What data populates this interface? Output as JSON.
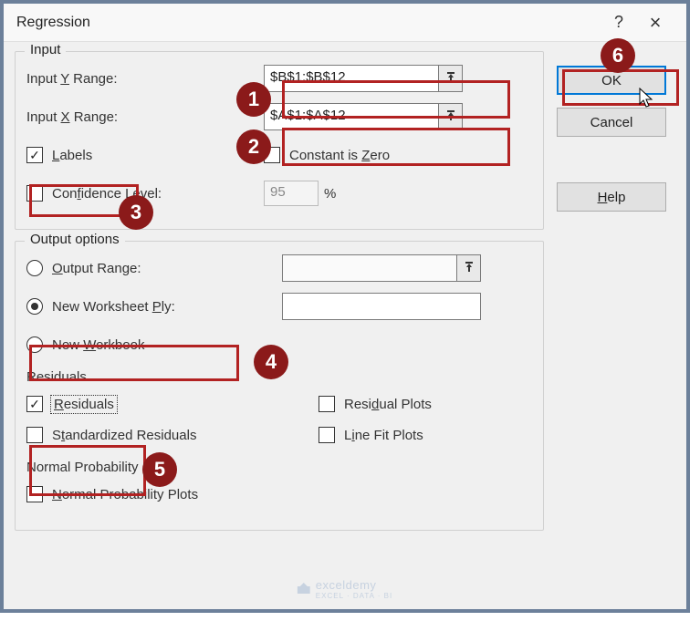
{
  "title": "Regression",
  "buttons": {
    "ok": "OK",
    "cancel": "Cancel",
    "help": "Help"
  },
  "input": {
    "legend": "Input",
    "y_label_pre": "Input ",
    "y_label_u": "Y",
    "y_label_post": " Range:",
    "y_value": "$B$1:$B$12",
    "x_label_pre": "Input ",
    "x_label_u": "X",
    "x_label_post": " Range:",
    "x_value": "$A$1:$A$12",
    "labels_u": "L",
    "labels_post": "abels",
    "constzero_pre": "Constant is ",
    "constzero_u": "Z",
    "constzero_post": "ero",
    "conf_pre": "Con",
    "conf_u": "f",
    "conf_post": "idence Level:",
    "conf_value": "95",
    "conf_pct": "%"
  },
  "output": {
    "legend": "Output options",
    "output_range_u": "O",
    "output_range_post": "utput Range:",
    "new_ws_pre": "New Worksheet ",
    "new_ws_u": "P",
    "new_ws_post": "ly:",
    "new_wb_pre": "New ",
    "new_wb_u": "W",
    "new_wb_post": "orkbook",
    "residuals_title": "Residuals",
    "residuals_u": "R",
    "residuals_post": "esiduals",
    "stdres_pre": "S",
    "stdres_u": "t",
    "stdres_post": "andardized Residuals",
    "resplot_pre": "Resi",
    "resplot_u": "d",
    "resplot_post": "ual Plots",
    "linefit_pre": "L",
    "linefit_u": "i",
    "linefit_post": "ne Fit Plots",
    "np_title": "Normal Probability",
    "np_u": "N",
    "np_post": "ormal Probability Plots"
  },
  "annotations": {
    "n1": "1",
    "n2": "2",
    "n3": "3",
    "n4": "4",
    "n5": "5",
    "n6": "6"
  },
  "watermark": {
    "main": "exceldemy",
    "sub": "EXCEL · DATA · BI"
  }
}
